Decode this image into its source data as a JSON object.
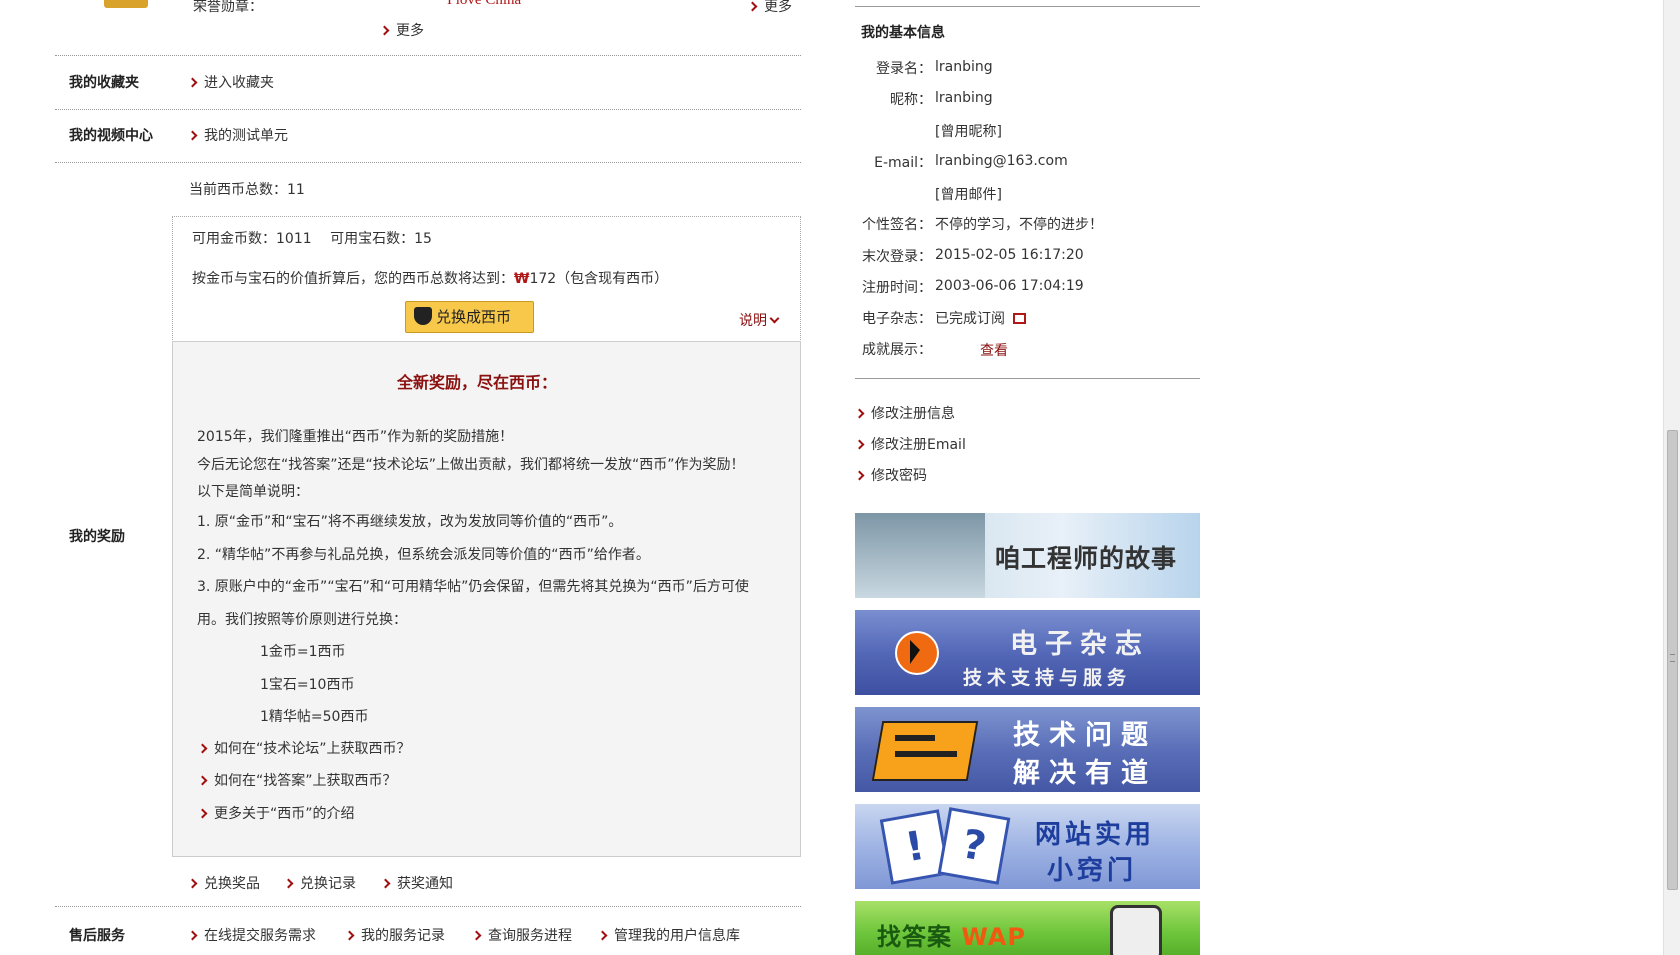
{
  "top": {
    "honor_label": "荣誉勋章：",
    "more_left": "更多",
    "more_right": "更多"
  },
  "rows": {
    "favorites_label": "我的收藏夹",
    "favorites_link": "进入收藏夹",
    "video_label": "我的视频中心",
    "video_link": "我的测试单元",
    "reward_label": "我的奖励",
    "aftersale_label": "售后服务"
  },
  "reward": {
    "current_total": "当前西币总数：11",
    "available": "可用金币数：1011　 可用宝石数：15",
    "converted_prefix": "按金币与宝石的价值折算后，您的西币总数将达到：",
    "converted_value": "172（包含现有西币）",
    "exchange_button": "兑换成西币",
    "explain": "说明",
    "heading": "全新奖励，尽在西币：",
    "para1": "2015年，我们隆重推出“西币”作为新的奖励措施！",
    "para2": "今后无论您在“找答案”还是“技术论坛”上做出贡献，我们都将统一发放“西币”作为奖励！",
    "para3": "以下是简单说明：",
    "item1": "1. 原“金币”和“宝石”将不再继续发放，改为发放同等价值的“西币”。",
    "item2": "2. “精华帖”不再参与礼品兑换，但系统会派发同等价值的“西币”给作者。",
    "item3a": "3. 原账户中的“金币”“宝石”和“可用精华帖”仍会保留，但需先将其兑换为“西币”后方可使",
    "item3b": "用。我们按照等价原则进行兑换：",
    "rate1": "1金币=1西币",
    "rate2": "1宝石=10西币",
    "rate3": "1精华帖=50西币",
    "howto1": "如何在“技术论坛”上获取西币？",
    "howto2": "如何在“找答案”上获取西币？",
    "howto3": "更多关于“西币”的介绍",
    "bottom_links": [
      "兑换奖品",
      "兑换记录",
      "获奖通知"
    ]
  },
  "aftersale_links": [
    "在线提交服务需求",
    "我的服务记录",
    "查询服务进程",
    "管理我的用户信息库"
  ],
  "profile": {
    "title": "我的基本信息",
    "login_label": "登录名：",
    "login_value": "lranbing",
    "nick_label": "昵称：",
    "nick_value": "lranbing",
    "nick_history": "[曾用昵称]",
    "email_label": "E-mail：",
    "email_value": "lranbing@163.com",
    "email_history": "[曾用邮件]",
    "signature_label": "个性签名：",
    "signature_value": "不停的学习，不停的进步！",
    "lastlogin_label": "末次登录：",
    "lastlogin_value": "2015-02-05 16:17:20",
    "register_label": "注册时间：",
    "register_value": "2003-06-06 17:04:19",
    "magazine_label": "电子杂志：",
    "magazine_value": "已完成订阅",
    "achieve_label": "成就展示：",
    "achieve_link": "查看"
  },
  "profile_links": [
    "修改注册信息",
    "修改注册Email",
    "修改密码"
  ],
  "banners": {
    "b1": "咱工程师的故事",
    "b2_line1": "电子杂志",
    "b2_line2": "技术支持与服务",
    "b3_line1": "技术问题",
    "b3_line2": "解决有道",
    "b4_line1": "网站实用",
    "b4_line2": "小窍门",
    "b5_a": "找答案",
    "b5_b": "WAP"
  }
}
